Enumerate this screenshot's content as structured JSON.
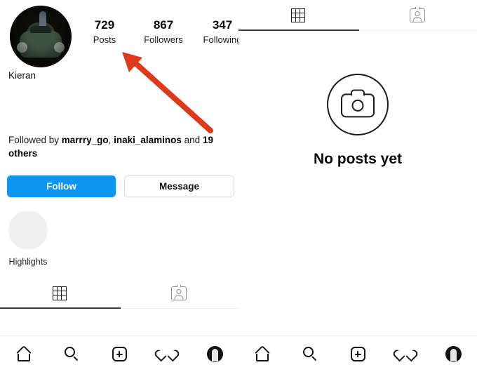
{
  "profile": {
    "username": "Kieran",
    "avatar_icon": "profile-avatar-car-image",
    "stats": [
      {
        "value": "729",
        "label": "Posts"
      },
      {
        "value": "867",
        "label": "Followers"
      },
      {
        "value": "347",
        "label": "Following"
      }
    ],
    "followed_by": {
      "prefix": "Followed by ",
      "name1": "marrry_go",
      "separator": ", ",
      "name2": "inaki_alaminos",
      "conjunction": " and ",
      "others": "19 others"
    },
    "buttons": {
      "follow_label": "Follow",
      "message_label": "Message"
    },
    "highlights": {
      "label": "Highlights",
      "circle_icon": "highlight-placeholder-circle"
    }
  },
  "tabs": {
    "grid_icon": "grid-icon",
    "tagged_icon": "tagged-photos-icon",
    "active": "grid"
  },
  "empty_state": {
    "icon": "camera-icon",
    "title": "No posts yet"
  },
  "bottom_nav": {
    "items": [
      {
        "icon": "home-icon"
      },
      {
        "icon": "search-icon"
      },
      {
        "icon": "add-post-icon"
      },
      {
        "icon": "heart-icon"
      },
      {
        "icon": "profile-avatar-icon"
      }
    ]
  },
  "annotation": {
    "arrow_color": "#DE3A1A",
    "points_to": "Posts"
  },
  "colors": {
    "follow_blue": "#0D95F2",
    "border_gray": "#DCDCDC",
    "highlight_gray": "#EFEFEF",
    "arrow_red": "#DE3A1A"
  }
}
